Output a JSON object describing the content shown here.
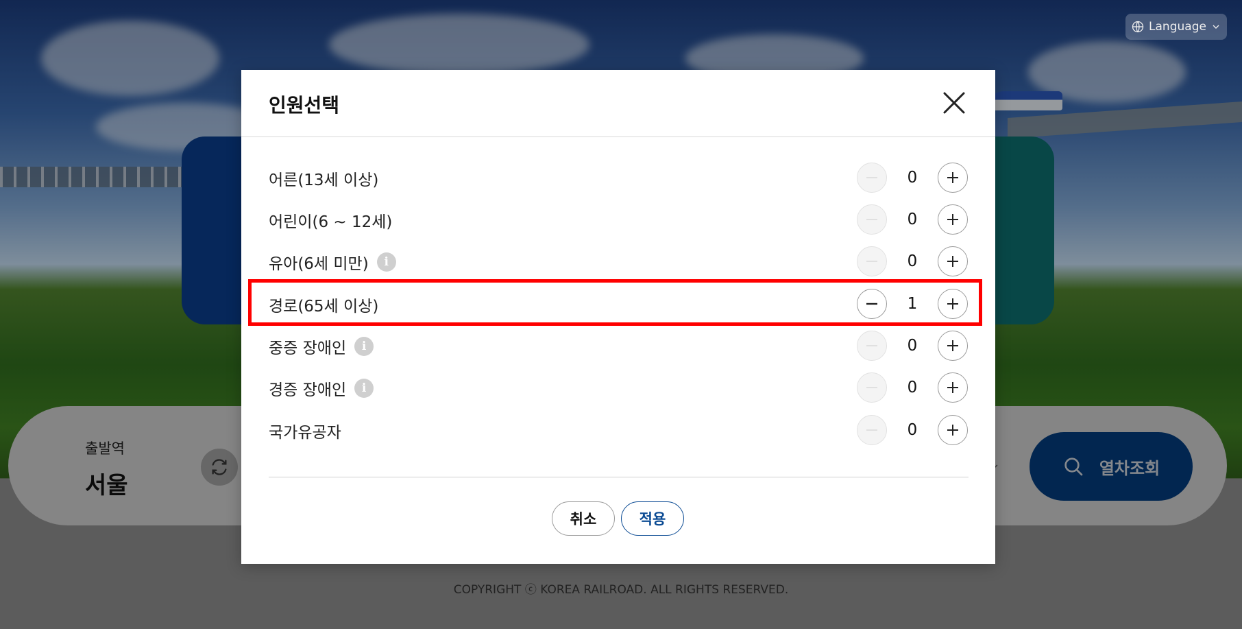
{
  "header": {
    "language_label": "Language"
  },
  "search": {
    "departure_label": "출발역",
    "departure_value": "서울",
    "search_button_label": "열차조회"
  },
  "footer": {
    "copyright": "COPYRIGHT ⓒ KOREA RAILROAD. ALL RIGHTS RESERVED."
  },
  "modal": {
    "title": "인원선택",
    "rows": [
      {
        "label": "어른(13세 이상)",
        "count": "0",
        "has_info": false
      },
      {
        "label": "어린이(6 ~ 12세)",
        "count": "0",
        "has_info": false
      },
      {
        "label": "유아(6세 미만)",
        "count": "0",
        "has_info": true
      },
      {
        "label": "경로(65세 이상)",
        "count": "1",
        "has_info": false,
        "highlighted": true
      },
      {
        "label": "중증 장애인",
        "count": "0",
        "has_info": true
      },
      {
        "label": "경증 장애인",
        "count": "0",
        "has_info": true
      },
      {
        "label": "국가유공자",
        "count": "0",
        "has_info": false
      }
    ],
    "cancel_label": "취소",
    "apply_label": "적용"
  },
  "colors": {
    "primary": "#0a4a93",
    "search_button": "#033a78",
    "highlight": "#ff0000"
  }
}
